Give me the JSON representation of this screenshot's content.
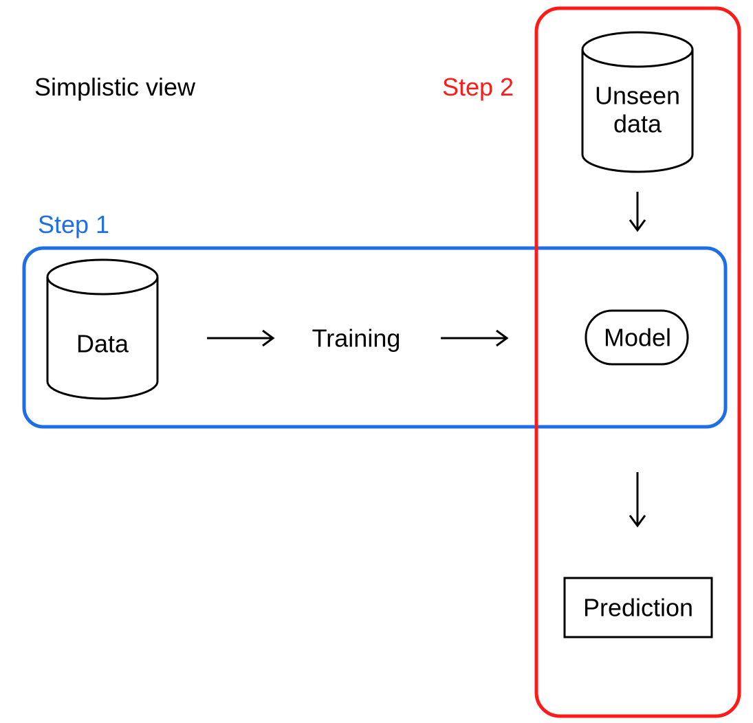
{
  "title": "Simplistic view",
  "step1": {
    "label": "Step 1",
    "color": "#1e6fe6"
  },
  "step2": {
    "label": "Step 2",
    "color": "#ff1a1a"
  },
  "nodes": {
    "data": "Data",
    "training": "Training",
    "model": "Model",
    "unseen": "Unseen\ndata",
    "prediction": "Prediction"
  }
}
